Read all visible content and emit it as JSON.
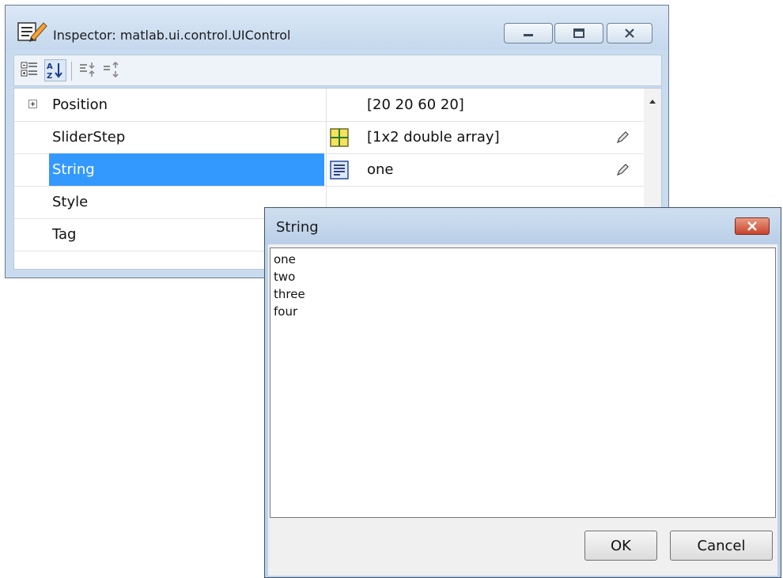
{
  "inspector": {
    "title": "Inspector:  matlab.ui.control.UIControl",
    "toolbar": [
      "categorized-view-icon",
      "alphabetical-sort-icon",
      "expand-all-icon",
      "collapse-all-icon"
    ],
    "properties": [
      {
        "name": "Position",
        "value": "[20 20 60 20]",
        "expandable": true,
        "editor": "",
        "selected": false
      },
      {
        "name": "SliderStep",
        "value": "[1x2  double array]",
        "expandable": false,
        "editor": "array-editor-icon",
        "selected": false
      },
      {
        "name": "String",
        "value": "one",
        "expandable": false,
        "editor": "text-editor-icon",
        "selected": true
      },
      {
        "name": "Style",
        "value": "",
        "expandable": false,
        "editor": "",
        "selected": false
      },
      {
        "name": "Tag",
        "value": "",
        "expandable": false,
        "editor": "",
        "selected": false
      }
    ]
  },
  "string_dialog": {
    "title": "String",
    "text": "one\ntwo\nthree\nfour\n",
    "ok_label": "OK",
    "cancel_label": "Cancel"
  },
  "colors": {
    "selection": "#3399ff",
    "window_frame": "#c9dbee",
    "close_button": "#c8442a"
  }
}
